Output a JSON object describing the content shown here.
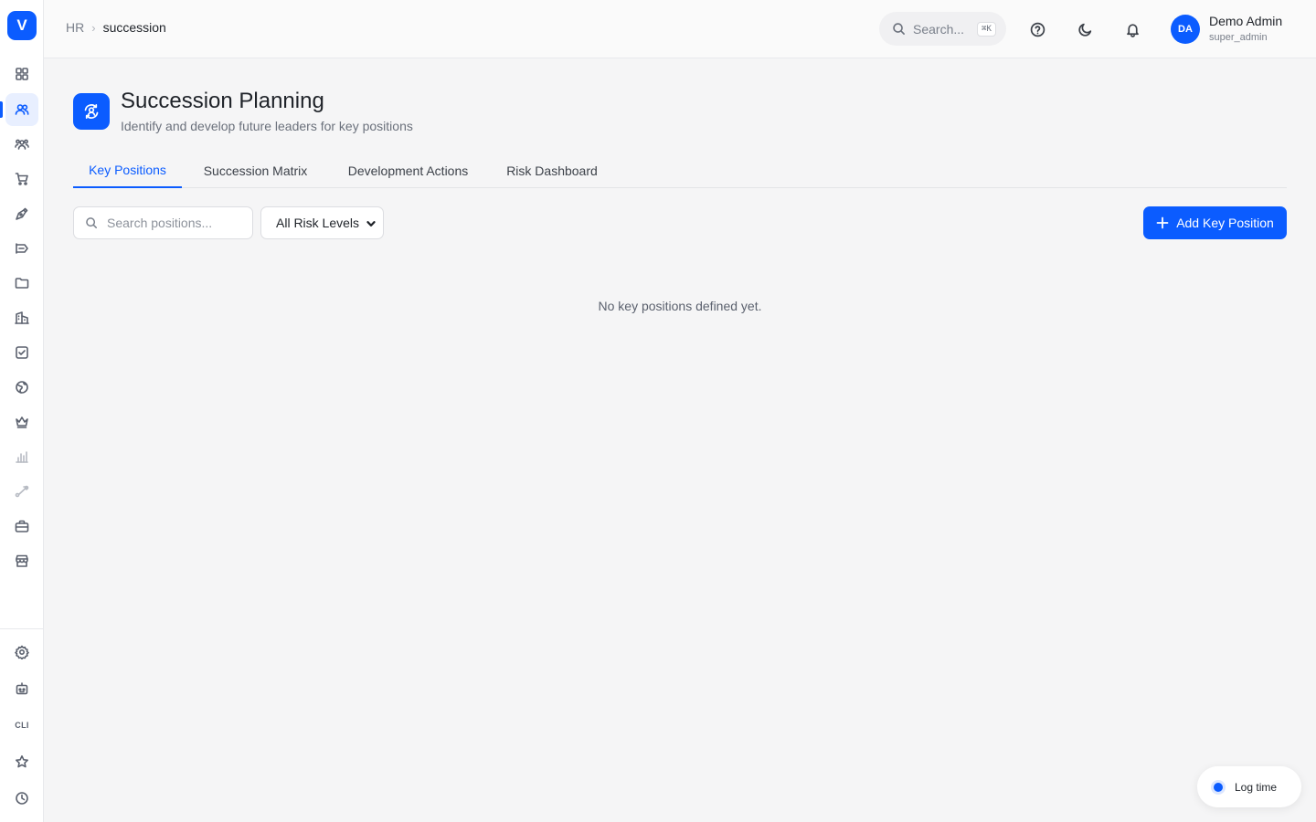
{
  "sidebar": {
    "logo_letter": "V",
    "items": [
      {
        "name": "dashboard",
        "icon": "grid-icon"
      },
      {
        "name": "hr",
        "icon": "users-icon",
        "active": true
      },
      {
        "name": "teams",
        "icon": "group-icon"
      },
      {
        "name": "commerce",
        "icon": "cart-icon"
      },
      {
        "name": "design",
        "icon": "pen-tool-icon"
      },
      {
        "name": "marketing",
        "icon": "megaphone-icon"
      },
      {
        "name": "files",
        "icon": "folder-icon"
      },
      {
        "name": "buildings",
        "icon": "building-icon"
      },
      {
        "name": "tasks",
        "icon": "checkbox-icon"
      },
      {
        "name": "globe",
        "icon": "globe-icon"
      },
      {
        "name": "crown",
        "icon": "crown-icon"
      },
      {
        "name": "analytics",
        "icon": "bar-chart-icon",
        "muted": true
      },
      {
        "name": "workflow",
        "icon": "route-icon",
        "muted": true
      },
      {
        "name": "jobs",
        "icon": "briefcase-icon"
      },
      {
        "name": "store",
        "icon": "store-icon"
      }
    ],
    "bottom": {
      "settings": "gear-icon",
      "bot": "robot-icon",
      "cli_label": "CLI",
      "favorites": "star-icon",
      "history": "clock-icon"
    }
  },
  "topbar": {
    "breadcrumb": {
      "root": "HR",
      "current": "succession"
    },
    "search": {
      "placeholder": "Search...",
      "shortcut": "⌘K"
    },
    "icons": [
      "help-icon",
      "moon-icon",
      "bell-icon"
    ],
    "user": {
      "initials": "DA",
      "name": "Demo Admin",
      "role": "super_admin"
    }
  },
  "page": {
    "title": "Succession Planning",
    "subtitle": "Identify and develop future leaders for key positions"
  },
  "tabs": [
    {
      "label": "Key Positions",
      "active": true
    },
    {
      "label": "Succession Matrix"
    },
    {
      "label": "Development Actions"
    },
    {
      "label": "Risk Dashboard"
    }
  ],
  "toolbar": {
    "search_placeholder": "Search positions...",
    "risk_filter": "All Risk Levels",
    "add_label": "Add Key Position"
  },
  "empty_state": "No key positions defined yet.",
  "log_time": {
    "label": "Log time"
  },
  "colors": {
    "accent": "#0b5cff",
    "background": "#f5f5f6"
  }
}
